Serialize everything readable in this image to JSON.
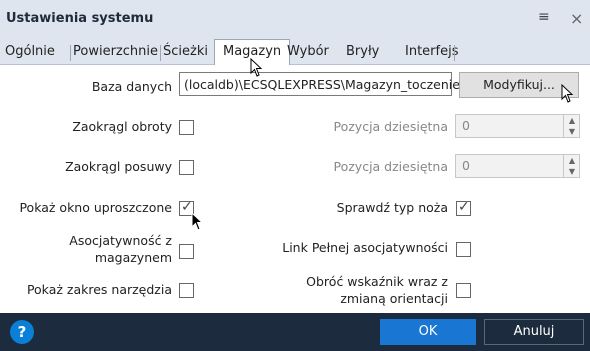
{
  "window": {
    "title": "Ustawienia systemu",
    "grip_icon": "≡",
    "close_icon": "×"
  },
  "tabs": [
    {
      "label": "Ogólnie"
    },
    {
      "label": "Powierzchnie"
    },
    {
      "label": "Ścieżki"
    },
    {
      "label": "Magazyn",
      "active": true
    },
    {
      "label": "Wybór"
    },
    {
      "label": "Bryły"
    },
    {
      "label": "Interfejs"
    }
  ],
  "database": {
    "label": "Baza danych",
    "value": "(localdb)\\ECSQLEXPRESS\\Magazyn_toczenie",
    "modify_label": "Modyfikuj..."
  },
  "options": {
    "round_speed": {
      "label": "Zaokrągl obroty",
      "checked": false
    },
    "round_feed": {
      "label": "Zaokrągl posuwy",
      "checked": false
    },
    "show_simplified": {
      "label": "Pokaż okno uproszczone",
      "checked": true
    },
    "associativity_line1": "Asocjatywność z",
    "associativity_line2": "magazynem",
    "associativity_checked": false,
    "show_tool_range": {
      "label": "Pokaż zakres narzędzia",
      "checked": false
    },
    "decimal_position_1": {
      "label": "Pozycja dziesiętna",
      "value": "0"
    },
    "decimal_position_2": {
      "label": "Pozycja dziesiętna",
      "value": "0"
    },
    "check_tool_type": {
      "label": "Sprawdź typ noża",
      "checked": true
    },
    "full_assoc_link": {
      "label": "Link Pełnej asocjatywności",
      "checked": false
    },
    "rotate_line1": "Obróć wskaźnik wraz z",
    "rotate_line2": "zmianą orientacji",
    "rotate_checked": false
  },
  "footer": {
    "help_icon": "?",
    "ok_label": "OK",
    "cancel_label": "Anuluj"
  },
  "colors": {
    "titlebar": "#dfe5ee",
    "footer": "#1c2b3d",
    "ok": "#1976d2",
    "help": "#0a7fd6"
  }
}
